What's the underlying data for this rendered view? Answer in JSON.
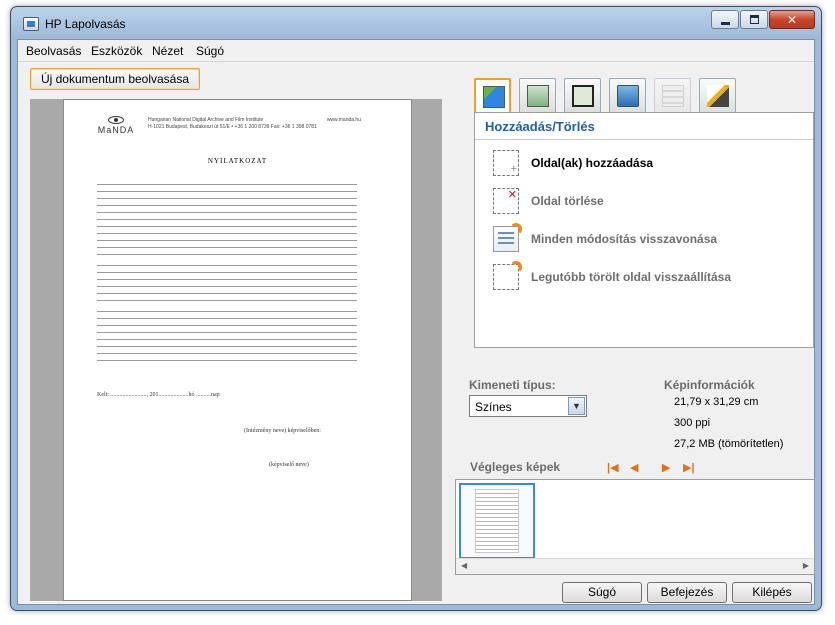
{
  "window": {
    "title": "HP Lapolvasás"
  },
  "menu": [
    "Beolvasás",
    "Eszközök",
    "Nézet",
    "Súgó"
  ],
  "scan_button": "Új dokumentum beolvasása",
  "document": {
    "org_line1": "Hungarian National Digital Archive and Film Institute",
    "org_line2": "H-1021 Budapest, Budakeszi út 51/E • +36 1 200 8739 Fax: +36 1 398 0781",
    "website": "www.manda.hu",
    "logo": "MaNDA",
    "heading": "NYILATKOZAT",
    "date_line": "Kelt: ........................, 201....................hó ..........nap",
    "sig1": "(Intézmény neve) képviselőben:",
    "sig2": "(képviselő neve)"
  },
  "panel": {
    "title": "Hozzáadás/Törlés",
    "actions": [
      {
        "label": "Oldal(ak) hozzáadása",
        "enabled": true,
        "icon": "add-page-icon"
      },
      {
        "label": "Oldal törlése",
        "enabled": false,
        "icon": "delete-page-icon"
      },
      {
        "label": "Minden módosítás visszavonása",
        "enabled": false,
        "icon": "undo-all-icon"
      },
      {
        "label": "Legutóbb törölt oldal visszaállítása",
        "enabled": false,
        "icon": "restore-page-icon"
      }
    ]
  },
  "output": {
    "label": "Kimeneti típus:",
    "selected": "Színes"
  },
  "image_info": {
    "label": "Képinformációk",
    "size": "21,79 x 31,29 cm",
    "dpi": "300 ppi",
    "filesize": "27,2 MB (tömörítetlen)"
  },
  "final_images": {
    "label": "Végleges képek"
  },
  "buttons": {
    "help": "Súgó",
    "finish": "Befejezés",
    "exit": "Kilépés"
  }
}
